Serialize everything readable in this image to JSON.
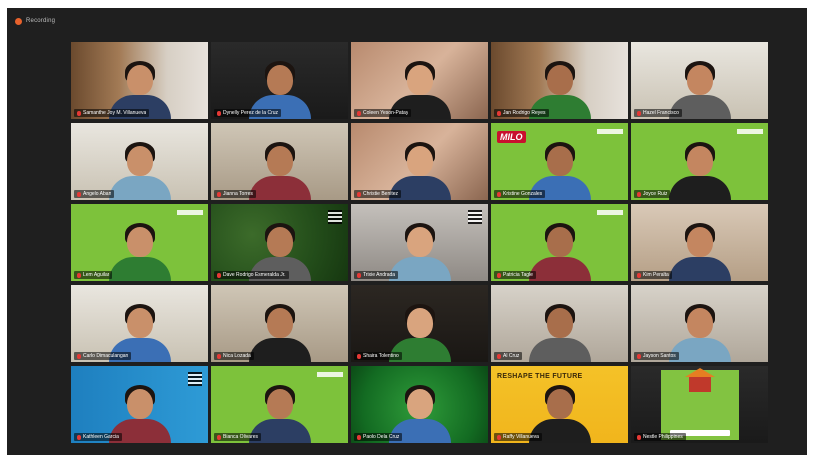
{
  "window": {
    "title": "Recording",
    "recording_color": "#e8622c"
  },
  "tiles": [
    {
      "name": "Samanthe Joy M. Villanueva",
      "bg": "bg-shelf"
    },
    {
      "name": "Dynelly Perez de la Cruz",
      "bg": "bg-dark"
    },
    {
      "name": "Coleen Yeson-Patay",
      "bg": "bg-room3"
    },
    {
      "name": "Jan Rodrigo Reyes",
      "bg": "bg-shelf"
    },
    {
      "name": "Hazel Francisco",
      "bg": "bg-room2"
    },
    {
      "name": "Angelo Aban",
      "bg": "bg-room2"
    },
    {
      "name": "Jianna Torres",
      "bg": "bg-room"
    },
    {
      "name": "Christie Benitez",
      "bg": "bg-room3"
    },
    {
      "name": "Kristine Gonzales",
      "bg": "bg-green",
      "brand": "MILO"
    },
    {
      "name": "Joyce Ruiz",
      "bg": "bg-green"
    },
    {
      "name": "Lem Aguilar",
      "bg": "bg-green"
    },
    {
      "name": "Dave Rodrigo Esmeralda Jr.",
      "bg": "bg-leaf"
    },
    {
      "name": "Trixie Andrada",
      "bg": "bg-gray"
    },
    {
      "name": "Patricia Tagle",
      "bg": "bg-green"
    },
    {
      "name": "Kim Peralta",
      "bg": "bg-bedroom"
    },
    {
      "name": "Carlo Dimaculangan",
      "bg": "bg-room2"
    },
    {
      "name": "Nica Lozada",
      "bg": "bg-room"
    },
    {
      "name": "Shaira Tolentino",
      "bg": "bg-night"
    },
    {
      "name": "Al Cruz",
      "bg": "bg-office"
    },
    {
      "name": "Jayson Santos",
      "bg": "bg-office"
    },
    {
      "name": "Kathleen Garcia",
      "bg": "bg-blue"
    },
    {
      "name": "Bianca Olivares",
      "bg": "bg-green"
    },
    {
      "name": "Paolo Dela Cruz",
      "bg": "bg-darkgreen"
    },
    {
      "name": "Raffy Villanueva",
      "bg": "bg-yellow",
      "headline": "RESHAPE THE FUTURE"
    },
    {
      "name": "Nestle Philippines",
      "bg": "bg-dark",
      "poster": true
    }
  ]
}
